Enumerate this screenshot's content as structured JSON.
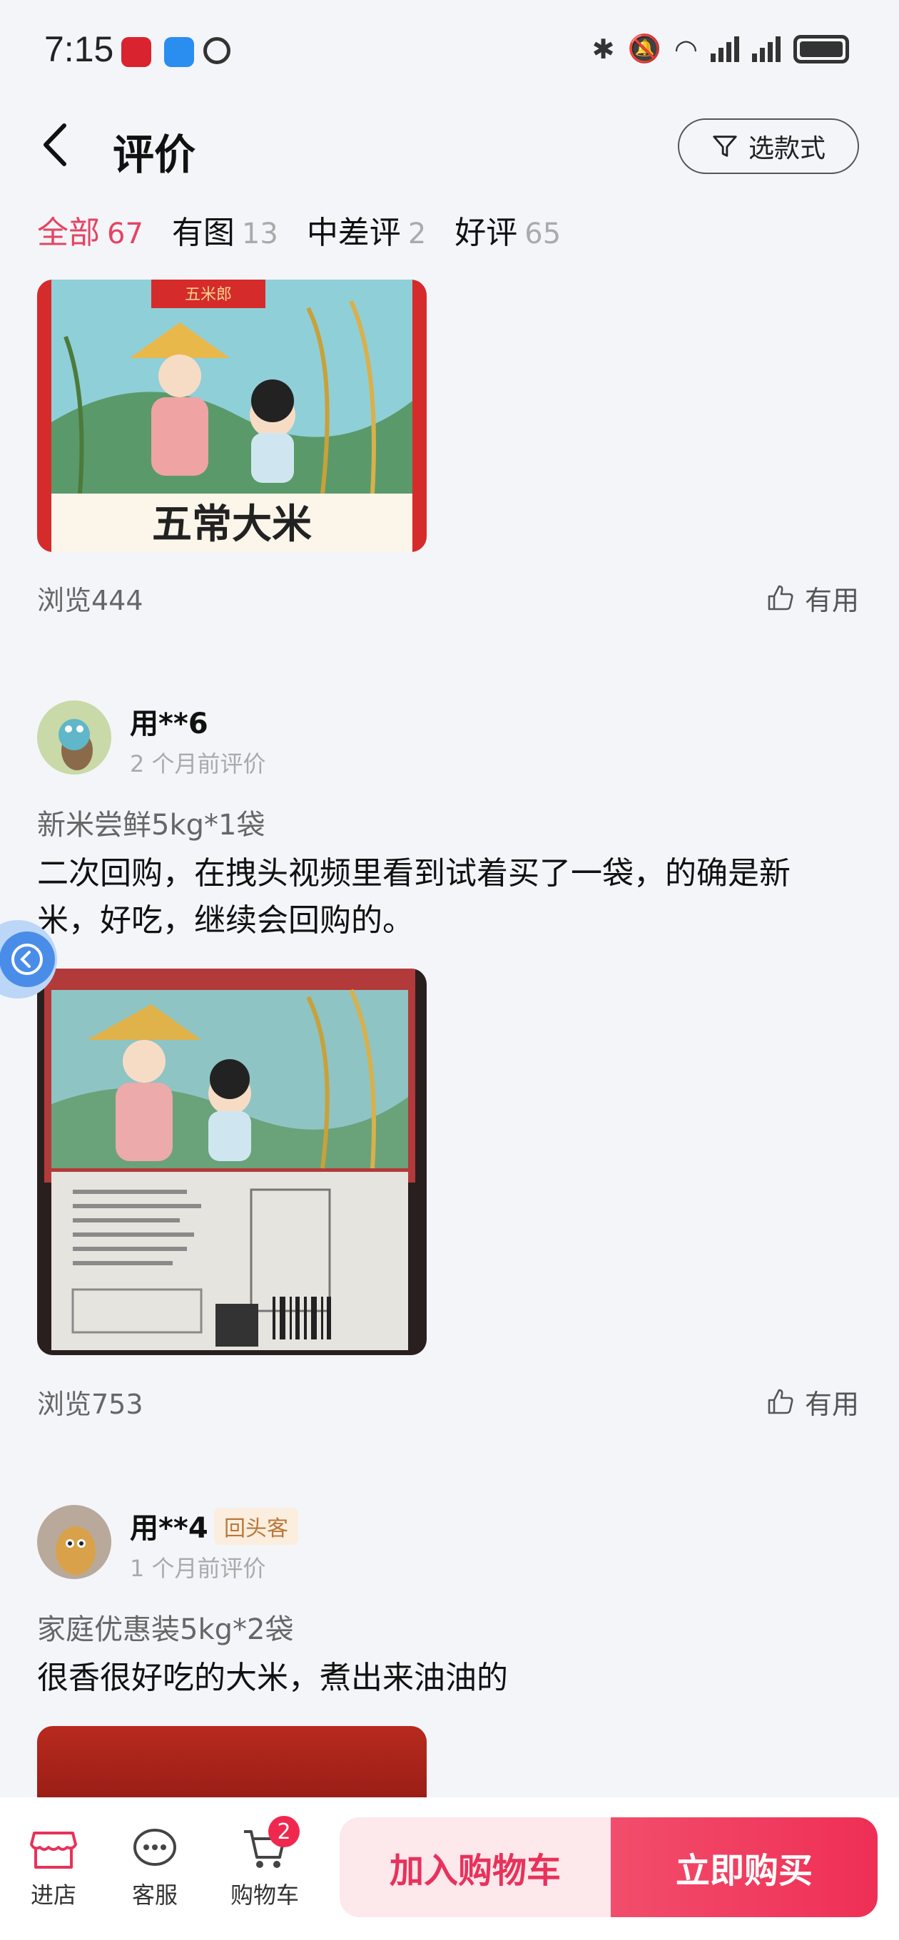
{
  "status": {
    "time": "7:15"
  },
  "header": {
    "title": "评价",
    "style_button": "选款式"
  },
  "tabs": [
    {
      "label": "全部",
      "count": "67"
    },
    {
      "label": "有图",
      "count": "13"
    },
    {
      "label": "中差评",
      "count": "2"
    },
    {
      "label": "好评",
      "count": "65"
    }
  ],
  "review0": {
    "image_caption": "五常大米",
    "image_brand": "五米郎",
    "views": "浏览444",
    "useful": "有用"
  },
  "review1": {
    "user": "用**6",
    "date": "2 个月前评价",
    "variant": "新米尝鲜5kg*1袋",
    "text": "二次回购，在拽头视频里看到试着买了一袋，的确是新米，好吃，继续会回购的。",
    "views": "浏览753",
    "useful": "有用"
  },
  "review2": {
    "user": "用**4",
    "badge": "回头客",
    "date": "1 个月前评价",
    "variant": "家庭优惠装5kg*2袋",
    "text": "很香很好吃的大米，煮出来油油的"
  },
  "bottom": {
    "store": "进店",
    "service": "客服",
    "cart": "购物车",
    "cart_count": "2",
    "add_to_cart": "加入购物车",
    "buy_now": "立即购买"
  },
  "colors": {
    "accent": "#e54461",
    "buy": "#ef2f55"
  }
}
